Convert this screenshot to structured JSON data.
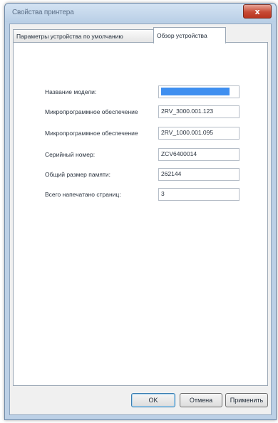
{
  "window": {
    "title": "Свойства принтера",
    "close_label": "x"
  },
  "tabs": [
    {
      "label": "Параметры устройства по умолчанию",
      "active": false
    },
    {
      "label": "Обзор устройства",
      "active": true
    }
  ],
  "device_overview": {
    "model_name": {
      "label": "Название модели:",
      "value": ""
    },
    "firmware_1": {
      "label": "Микропрограммное обеспечение",
      "value": "2RV_3000.001.123"
    },
    "firmware_2": {
      "label": "Микропрограммное обеспечение",
      "value": "2RV_1000.001.095"
    },
    "serial": {
      "label": "Серийный номер:",
      "value": "ZCV6400014"
    },
    "memory": {
      "label": "Общий размер памяти:",
      "value": "262144"
    },
    "pages": {
      "label": "Всего напечатано страниц:",
      "value": "3"
    }
  },
  "buttons": {
    "ok": "OK",
    "cancel": "Отмена",
    "apply": "Применить"
  }
}
